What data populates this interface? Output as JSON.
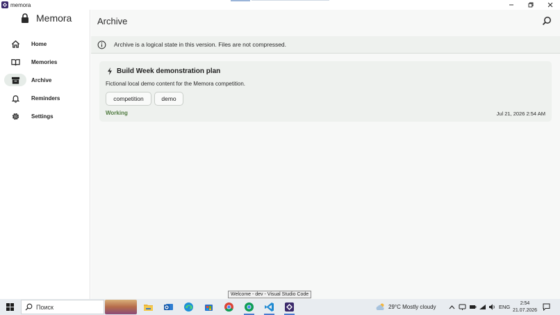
{
  "window": {
    "title": "memora",
    "controls": [
      "minimize-icon",
      "restore-icon",
      "close-icon"
    ]
  },
  "sidebar": {
    "brand": "Memora",
    "items": [
      {
        "label": "Home",
        "icon": "home-icon"
      },
      {
        "label": "Memories",
        "icon": "book-icon"
      },
      {
        "label": "Archive",
        "icon": "archive-icon",
        "active": true
      },
      {
        "label": "Reminders",
        "icon": "bell-icon"
      },
      {
        "label": "Settings",
        "icon": "gear-icon"
      }
    ]
  },
  "main": {
    "title": "Archive",
    "info": "Archive is a logical state in this version. Files are not compressed.",
    "card": {
      "title": "Build Week demonstration plan",
      "description": "Fictional local demo content for the Memora competition.",
      "tags": [
        "competition",
        "demo"
      ],
      "status": "Working",
      "date": "Jul 21, 2026 2:54 AM"
    }
  },
  "tooltip": "Welcome - dev - Visual Studio Code",
  "taskbar": {
    "search_placeholder": "Поиск",
    "weather": "29°C  Mostly cloudy",
    "language": "ENG",
    "time": "2:54",
    "date": "21.07.2026"
  },
  "colors": {
    "accent_green": "#4f7a3f",
    "active_nav_bg": "#e6ece8",
    "card_bg": "#eef1ee"
  }
}
